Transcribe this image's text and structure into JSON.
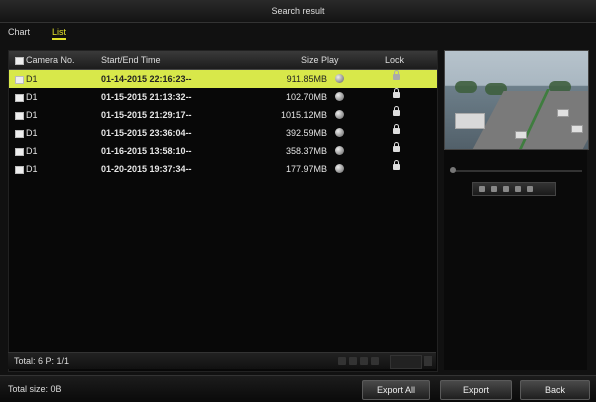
{
  "window": {
    "title": "Search result"
  },
  "tabs": [
    {
      "label": "Chart"
    },
    {
      "label": "List"
    }
  ],
  "table": {
    "headers": {
      "camera": "Camera No.",
      "time": "Start/End Time",
      "size_play": "Size Play",
      "lock": "Lock"
    },
    "rows": [
      {
        "camera": "D1",
        "time": "01-14-2015 22:16:23--",
        "size": "911.85MB"
      },
      {
        "camera": "D1",
        "time": "01-15-2015 21:13:32--",
        "size": "102.70MB"
      },
      {
        "camera": "D1",
        "time": "01-15-2015 21:29:17--",
        "size": "1015.12MB"
      },
      {
        "camera": "D1",
        "time": "01-15-2015 23:36:04--",
        "size": "392.59MB"
      },
      {
        "camera": "D1",
        "time": "01-16-2015 13:58:10--",
        "size": "358.37MB"
      },
      {
        "camera": "D1",
        "time": "01-20-2015 19:37:34--",
        "size": "177.97MB"
      }
    ],
    "footer": {
      "total": "Total: 6 P: 1/1"
    }
  },
  "status": {
    "total_size": "Total size: 0B"
  },
  "buttons": {
    "export_all": "Export All",
    "export": "Export",
    "back": "Back"
  },
  "colors": {
    "selected_row": "#d8e84a",
    "active_tab": "#e3e32a"
  }
}
